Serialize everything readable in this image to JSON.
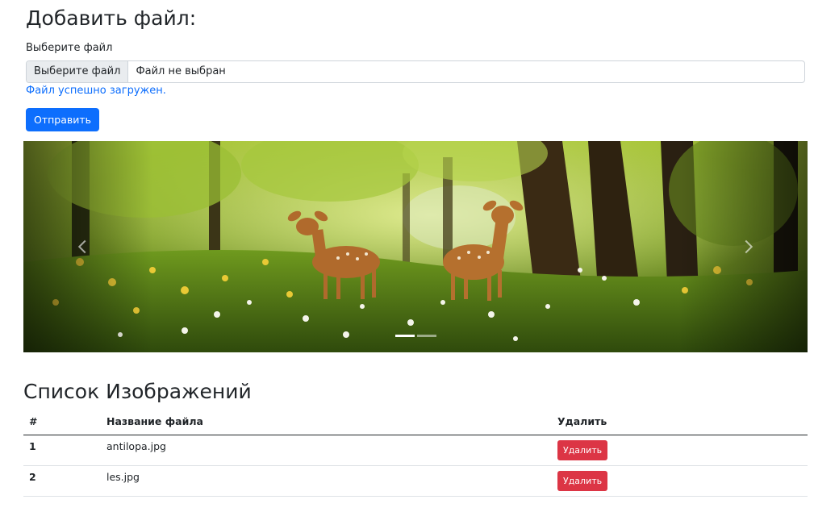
{
  "upload": {
    "heading": "Добавить файл:",
    "field_label": "Выберите файл",
    "choose_button": "Выберите файл",
    "file_status": "Файл не выбран",
    "success_message": "Файл успешно загружен.",
    "submit_label": "Отправить"
  },
  "carousel": {
    "slide_count": 2,
    "active_slide": 1,
    "prev_icon": "chevron-left-icon",
    "next_icon": "chevron-right-icon"
  },
  "images": {
    "heading": "Список Изображений",
    "columns": [
      "#",
      "Название файла",
      "Удалить"
    ],
    "rows": [
      {
        "num": "1",
        "filename": "antilopa.jpg",
        "delete_label": "Удалить"
      },
      {
        "num": "2",
        "filename": "les.jpg",
        "delete_label": "Удалить"
      }
    ]
  },
  "colors": {
    "primary": "#0d6efd",
    "danger": "#dc3545",
    "text": "#212529"
  }
}
